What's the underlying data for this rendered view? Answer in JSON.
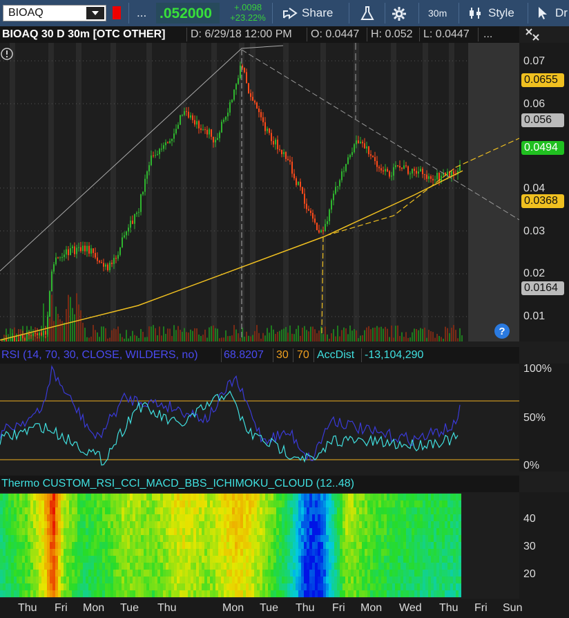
{
  "toolbar": {
    "symbol": "BIOAQ",
    "more": "...",
    "last": ".052000",
    "change_abs": "+.0098",
    "change_pct": "+23.22%",
    "share": "Share",
    "aggregation": "30m",
    "style": "Style",
    "drawings": "Dr"
  },
  "chart_header": {
    "title": "BIOAQ 30 D 30m [OTC OTHER]",
    "date": "D: 6/29/18 12:00 PM",
    "open": "O: 0.0447",
    "high": "H: 0.052",
    "low": "L: 0.0447",
    "more": "..."
  },
  "price_axis": {
    "ticks": [
      "0.07",
      "0.06",
      "0.04",
      "0.03",
      "0.02",
      "0.01"
    ],
    "tags": [
      {
        "value": "0.0655",
        "bg": "#f0c020",
        "fg": "#111"
      },
      {
        "value": "0.056",
        "bg": "#bbbbbb",
        "fg": "#111"
      },
      {
        "value": "0.0494",
        "bg": "#20c020",
        "fg": "#fff"
      },
      {
        "value": "0.0368",
        "bg": "#f0c020",
        "fg": "#111"
      },
      {
        "value": "0.0164",
        "bg": "#bbbbbb",
        "fg": "#111"
      }
    ]
  },
  "rsi_panel": {
    "label": "RSI (14, 70, 30, CLOSE, WILDERS, no)",
    "value": "68.8207",
    "oversold": "30",
    "overbought": "70",
    "accdist_label": "AccDist",
    "accdist_value": "-13,104,290",
    "axis": [
      "100%",
      "50%",
      "0%"
    ]
  },
  "thermo_panel": {
    "label": "Thermo CUSTOM_RSI_CCI_MACD_BBS_ICHIMOKU_CLOUD (12..48)",
    "axis": [
      "40",
      "30",
      "20"
    ]
  },
  "time_axis": [
    "Thu",
    "Fri",
    "Mon",
    "Tue",
    "Thu",
    "Mon",
    "Tue",
    "Thu",
    "Fri",
    "Mon",
    "Wed",
    "Thu",
    "Fri",
    "Sun"
  ],
  "colors": {
    "up": "#2fb52f",
    "down": "#ff4a1a",
    "trendline": "#f0c020",
    "rsi": "#3a3ad8",
    "accdist": "#40e0e0",
    "toolbar": "#2e4a6c"
  },
  "icons": [
    "share-icon",
    "flask-icon",
    "gear-icon",
    "style-icon",
    "cursor-icon",
    "alert-info-icon",
    "help-icon",
    "crosshair-icon"
  ]
}
